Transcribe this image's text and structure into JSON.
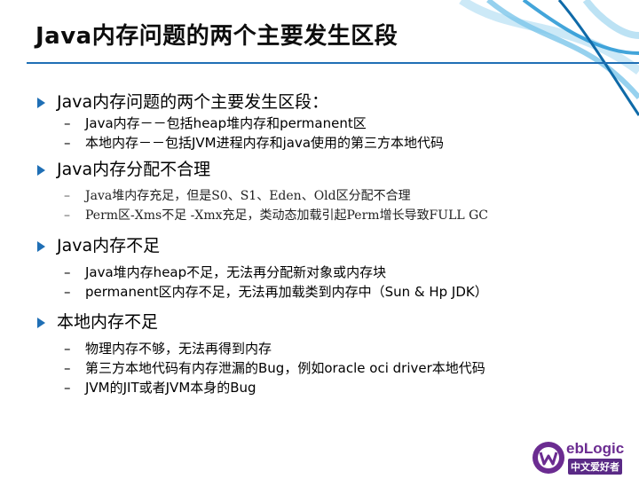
{
  "slide": {
    "title": "Java内存问题的两个主要发生区段",
    "sections": [
      {
        "heading": "Java内存问题的两个主要发生区段：",
        "items": [
          "Java内存－－包括heap堆内存和permanent区",
          "本地内存－－包括JVM进程内存和java使用的第三方本地代码"
        ]
      },
      {
        "heading": "Java内存分配不合理",
        "items": [
          "Java堆内存充足，但是S0、S1、Eden、Old区分配不合理",
          "Perm区-Xms不足 -Xmx充足，类动态加载引起Perm增长导致FULL GC"
        ]
      },
      {
        "heading": "Java内存不足",
        "items": [
          "Java堆内存heap不足，无法再分配新对象或内存块",
          "permanent区内存不足，无法再加载类到内存中（Sun & Hp JDK）"
        ]
      },
      {
        "heading": "本地内存不足",
        "items": [
          "物理内存不够，无法再得到内存",
          "第三方本地代码有内存泄漏的Bug，例如oracle oci driver本地代码",
          "JVM的JIT或者JVM本身的Bug"
        ]
      }
    ]
  },
  "logo": {
    "brand_text": "ebLogic",
    "subtitle": "中文爱好者"
  },
  "colors": {
    "accent": "#1f6fb5",
    "logo_purple": "#6b2c91"
  },
  "icons": {
    "bullet": "triangle-bullet-icon",
    "decoration": "blue-swirl-decoration",
    "logo": "weblogic-logo-icon"
  }
}
